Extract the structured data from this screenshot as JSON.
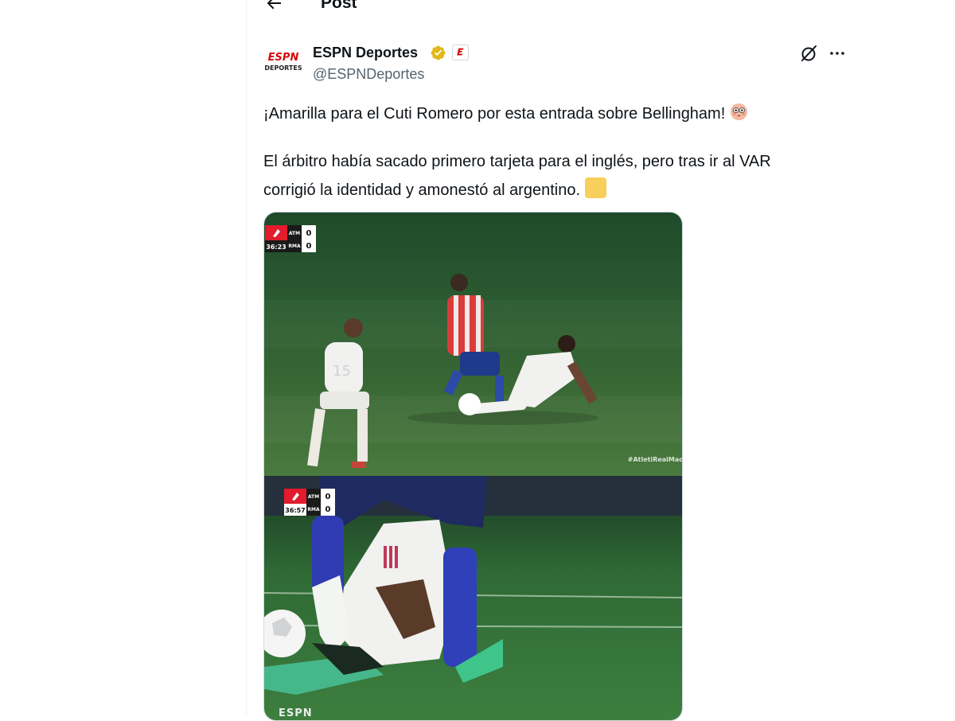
{
  "header": {
    "title": "Post"
  },
  "post": {
    "author_name": "ESPN Deportes",
    "handle": "@ESPNDeportes",
    "avatar_text": {
      "top": "ESPN",
      "bottom": "DEPORTES"
    },
    "text_line1": "¡Amarilla para el Cuti Romero por esta entrada sobre Bellingham!",
    "text_line2": "El árbitro había sacado primero tarjeta para el inglés, pero tras ir al VAR",
    "text_line3": "corrigió la identidad y amonestó al argentino."
  },
  "media": {
    "frame1": {
      "scorebug": {
        "team_home": "ATM",
        "team_away": "RMA",
        "score_home": "0",
        "score_away": "0",
        "clock": "36:23"
      },
      "watermark": "#AtletiRealMad"
    },
    "frame2": {
      "scorebug": {
        "team_home": "ATM",
        "team_away": "RMA",
        "score_home": "0",
        "score_away": "0",
        "clock": "36:57"
      },
      "brand": "ESPN"
    }
  },
  "colors": {
    "accent_verified": "#e2b719",
    "text_primary": "#0f1419",
    "text_secondary": "#536471",
    "yellow_card": "#f7cf5a"
  },
  "icons": [
    "back-arrow-icon",
    "verified-badge-icon",
    "affiliate-badge-icon",
    "grok-icon",
    "more-icon",
    "flushed-face-emoji",
    "yellow-square-emoji"
  ]
}
